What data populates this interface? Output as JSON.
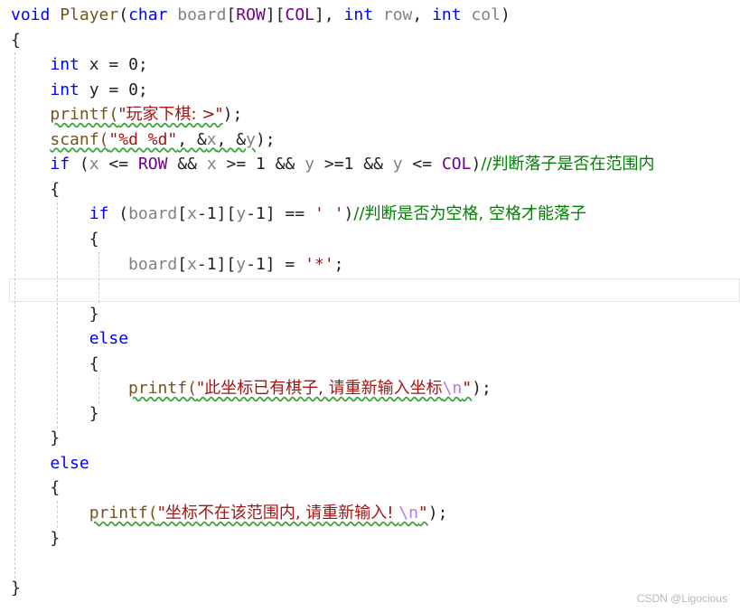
{
  "editor": {
    "lines": [
      {
        "segs": [
          {
            "t": "void",
            "c": "kw"
          },
          {
            "t": " Player",
            "c": "fn"
          },
          {
            "t": "(",
            "c": "ident"
          },
          {
            "t": "char",
            "c": "kw"
          },
          {
            "t": " board",
            "c": "param"
          },
          {
            "t": "[",
            "c": "ident"
          },
          {
            "t": "ROW",
            "c": "mac"
          },
          {
            "t": "][",
            "c": "ident"
          },
          {
            "t": "COL",
            "c": "mac"
          },
          {
            "t": "], ",
            "c": "ident"
          },
          {
            "t": "int",
            "c": "kw"
          },
          {
            "t": " row",
            "c": "param"
          },
          {
            "t": ", ",
            "c": "ident"
          },
          {
            "t": "int",
            "c": "kw"
          },
          {
            "t": " col",
            "c": "param"
          },
          {
            "t": ")",
            "c": "ident"
          }
        ]
      },
      {
        "segs": [
          {
            "t": "{",
            "c": "ident"
          }
        ]
      },
      {
        "segs": [
          {
            "t": "    ",
            "c": "ident"
          },
          {
            "t": "int",
            "c": "kw"
          },
          {
            "t": " x",
            "c": "ident"
          },
          {
            "t": " = 0;",
            "c": "ident"
          }
        ]
      },
      {
        "segs": [
          {
            "t": "    ",
            "c": "ident"
          },
          {
            "t": "int",
            "c": "kw"
          },
          {
            "t": " y",
            "c": "ident"
          },
          {
            "t": " = 0;",
            "c": "ident"
          }
        ]
      },
      {
        "segs": [
          {
            "t": "    ",
            "c": "ident"
          },
          {
            "t": "printf(",
            "c": "fn squig"
          },
          {
            "t": "\"玩家下棋: >\"",
            "c": "str zh squig"
          },
          {
            "t": ");",
            "c": "ident"
          }
        ]
      },
      {
        "segs": [
          {
            "t": "    ",
            "c": "ident"
          },
          {
            "t": "scanf(",
            "c": "fn squig"
          },
          {
            "t": "\"%d %d\"",
            "c": "str squig"
          },
          {
            "t": ", &",
            "c": "ident squig"
          },
          {
            "t": "x",
            "c": "param squig"
          },
          {
            "t": ", &",
            "c": "ident squig"
          },
          {
            "t": "y",
            "c": "param squig"
          },
          {
            "t": ");",
            "c": "ident"
          }
        ]
      },
      {
        "segs": [
          {
            "t": "    ",
            "c": "ident"
          },
          {
            "t": "if",
            "c": "kw"
          },
          {
            "t": " (",
            "c": "ident"
          },
          {
            "t": "x",
            "c": "param"
          },
          {
            "t": " <= ",
            "c": "ident"
          },
          {
            "t": "ROW",
            "c": "mac"
          },
          {
            "t": " && ",
            "c": "ident"
          },
          {
            "t": "x",
            "c": "param"
          },
          {
            "t": " >= 1 && ",
            "c": "ident"
          },
          {
            "t": "y",
            "c": "param"
          },
          {
            "t": " >=1 && ",
            "c": "ident"
          },
          {
            "t": "y",
            "c": "param"
          },
          {
            "t": " <= ",
            "c": "ident"
          },
          {
            "t": "COL",
            "c": "mac"
          },
          {
            "t": ")",
            "c": "ident"
          },
          {
            "t": "//判断落子是否在范围内",
            "c": "cmt"
          }
        ]
      },
      {
        "segs": [
          {
            "t": "    {",
            "c": "ident"
          }
        ]
      },
      {
        "segs": [
          {
            "t": "        ",
            "c": "ident"
          },
          {
            "t": "if",
            "c": "kw"
          },
          {
            "t": " (",
            "c": "ident"
          },
          {
            "t": "board",
            "c": "param"
          },
          {
            "t": "[",
            "c": "ident"
          },
          {
            "t": "x",
            "c": "param"
          },
          {
            "t": "-1][",
            "c": "ident"
          },
          {
            "t": "y",
            "c": "param"
          },
          {
            "t": "-1] == ",
            "c": "ident"
          },
          {
            "t": "' '",
            "c": "str"
          },
          {
            "t": ")",
            "c": "ident"
          },
          {
            "t": "//判断是否为空格, 空格才能落子",
            "c": "cmt"
          }
        ]
      },
      {
        "segs": [
          {
            "t": "        {",
            "c": "ident"
          }
        ]
      },
      {
        "segs": [
          {
            "t": "            ",
            "c": "ident"
          },
          {
            "t": "board",
            "c": "param"
          },
          {
            "t": "[",
            "c": "ident"
          },
          {
            "t": "x",
            "c": "param"
          },
          {
            "t": "-1][",
            "c": "ident"
          },
          {
            "t": "y",
            "c": "param"
          },
          {
            "t": "-1] = ",
            "c": "ident"
          },
          {
            "t": "'*'",
            "c": "str"
          },
          {
            "t": ";",
            "c": "ident"
          }
        ]
      },
      {
        "segs": []
      },
      {
        "segs": [
          {
            "t": "        }",
            "c": "ident"
          }
        ]
      },
      {
        "segs": [
          {
            "t": "        ",
            "c": "ident"
          },
          {
            "t": "else",
            "c": "kw"
          }
        ]
      },
      {
        "segs": [
          {
            "t": "        {",
            "c": "ident"
          }
        ]
      },
      {
        "segs": [
          {
            "t": "            ",
            "c": "ident"
          },
          {
            "t": "printf(",
            "c": "fn squig"
          },
          {
            "t": "\"此坐标已有棋子, 请重新输入坐标",
            "c": "str zh squig"
          },
          {
            "t": "\\n",
            "c": "esc squig"
          },
          {
            "t": "\"",
            "c": "str squig"
          },
          {
            "t": ");",
            "c": "ident"
          }
        ]
      },
      {
        "segs": [
          {
            "t": "        }",
            "c": "ident"
          }
        ]
      },
      {
        "segs": [
          {
            "t": "    }",
            "c": "ident"
          }
        ]
      },
      {
        "segs": [
          {
            "t": "    ",
            "c": "ident"
          },
          {
            "t": "else",
            "c": "kw"
          }
        ]
      },
      {
        "segs": [
          {
            "t": "    {",
            "c": "ident"
          }
        ]
      },
      {
        "segs": [
          {
            "t": "        ",
            "c": "ident"
          },
          {
            "t": "printf(",
            "c": "fn squig"
          },
          {
            "t": "\"坐标不在该范围内, 请重新输入! ",
            "c": "str zh squig"
          },
          {
            "t": "\\n",
            "c": "esc squig"
          },
          {
            "t": "\"",
            "c": "str squig"
          },
          {
            "t": ");",
            "c": "ident"
          }
        ]
      },
      {
        "segs": [
          {
            "t": "    }",
            "c": "ident"
          }
        ]
      },
      {
        "segs": []
      },
      {
        "segs": [
          {
            "t": "}",
            "c": "ident"
          }
        ]
      }
    ]
  },
  "watermark": "CSDN @Ligocious"
}
